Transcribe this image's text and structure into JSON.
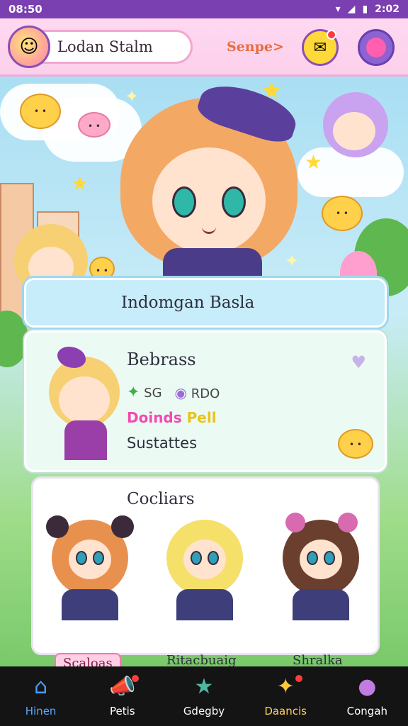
{
  "status_bar": {
    "time": "08:50",
    "right_time": "2:02",
    "icons": [
      "wifi-icon",
      "signal-icon",
      "battery-icon"
    ]
  },
  "header": {
    "app_title": "Lodan Stalm",
    "link_label": "Senpe>",
    "mail_icon": "mail-icon",
    "profile_icon": "profile-icon"
  },
  "hero": {
    "title": "Indomgan Basla"
  },
  "detail": {
    "name": "Bebrass",
    "stat1": "SG",
    "stat2": "RDO",
    "rank_prefix": "Doinds",
    "rank_suffix": "Pell",
    "status": "Sustattes"
  },
  "characters": {
    "title": "Cocliars",
    "items": [
      {
        "label": "Scaloas"
      },
      {
        "label": "Ritacbuaig"
      },
      {
        "label": "Shralka"
      }
    ]
  },
  "nav": {
    "items": [
      {
        "label": "Hinen",
        "icon": "home-icon"
      },
      {
        "label": "Petis",
        "icon": "megaphone-icon"
      },
      {
        "label": "Gdegby",
        "icon": "star-icon"
      },
      {
        "label": "Daancis",
        "icon": "bell-icon"
      },
      {
        "label": "Congah",
        "icon": "person-icon"
      }
    ],
    "active": "Hinen"
  },
  "colors": {
    "accent": "#7a3fb0",
    "pink": "#f24ab1",
    "nav_active": "#5aa8ff"
  }
}
